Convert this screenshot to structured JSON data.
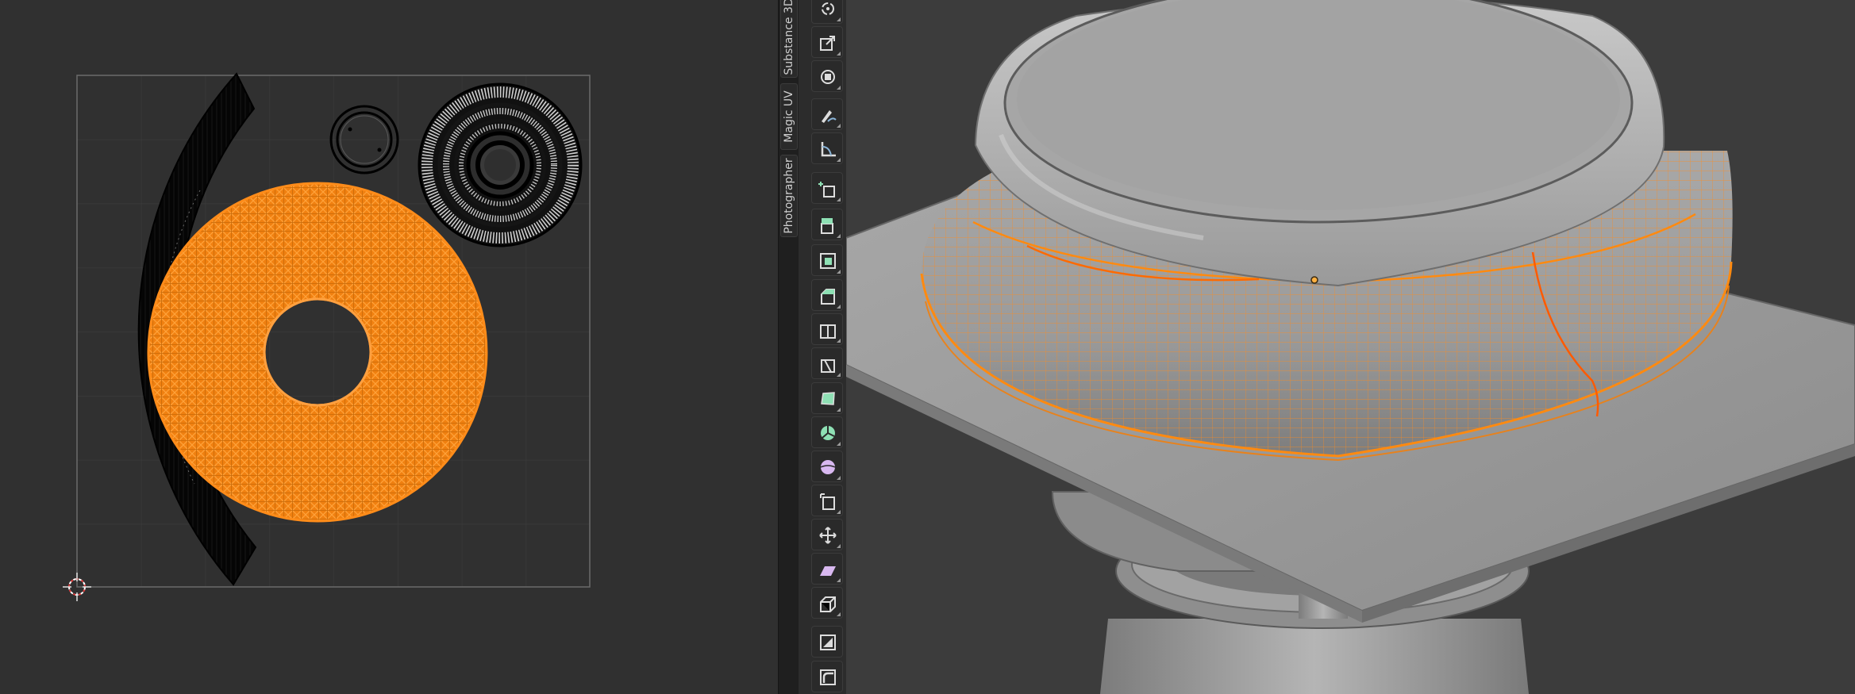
{
  "sidebar_tabs": [
    {
      "label": "Photographer"
    },
    {
      "label": "Magic UV"
    },
    {
      "label": "Substance 3D"
    }
  ],
  "toolbar": {
    "tools": [
      {
        "icon": "rotate-icon"
      },
      {
        "icon": "scale-icon"
      },
      {
        "icon": "transform-icon"
      },
      {
        "icon": "annotate-icon"
      },
      {
        "icon": "measure-icon"
      },
      {
        "icon": "add-cube-icon"
      },
      {
        "icon": "extrude-region-icon"
      },
      {
        "icon": "inset-faces-icon"
      },
      {
        "icon": "bevel-icon"
      },
      {
        "icon": "loop-cut-icon"
      },
      {
        "icon": "knife-icon"
      },
      {
        "icon": "poly-build-icon"
      },
      {
        "icon": "spin-icon"
      },
      {
        "icon": "smooth-vertices-icon"
      },
      {
        "icon": "edge-slide-icon"
      },
      {
        "icon": "shrink-fatten-icon"
      },
      {
        "icon": "shear-icon"
      },
      {
        "icon": "rip-region-icon"
      },
      {
        "icon": "uv-select-box-icon"
      },
      {
        "icon": "uv-stitch-icon"
      }
    ]
  },
  "colors": {
    "selection_orange": "#ff8a10",
    "uv_background": "#303030",
    "viewport_background": "#3c3c3c"
  }
}
